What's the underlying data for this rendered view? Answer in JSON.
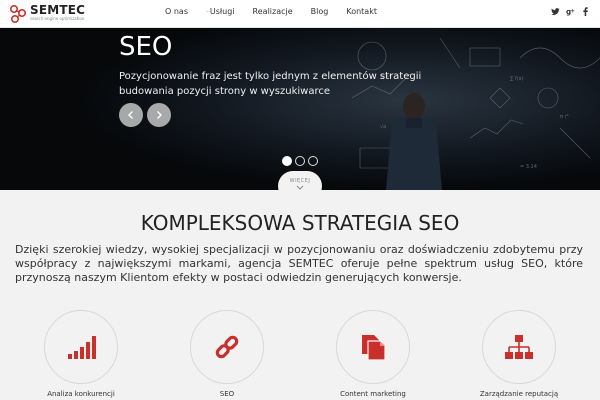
{
  "header": {
    "logo_text": "SEMTEC",
    "logo_sub": "search engine optimization",
    "nav": [
      {
        "label": "O nas",
        "dash": false
      },
      {
        "label": "Usługi",
        "dash": true
      },
      {
        "label": "Realizacje",
        "dash": false
      },
      {
        "label": "Blog",
        "dash": false
      },
      {
        "label": "Kontakt",
        "dash": false
      }
    ],
    "social": [
      {
        "icon": "twitter-icon",
        "glyph": "t"
      },
      {
        "icon": "google-plus-icon",
        "glyph": "g+"
      },
      {
        "icon": "facebook-icon",
        "glyph": "f"
      }
    ]
  },
  "hero": {
    "title": "SEO",
    "text": "Pozycjonowanie fraz jest tylko jednym z elementów strategii budowania pozycji strony w wyszukiwarce",
    "slides_total": 3,
    "active_slide": 1,
    "more_label": "WIĘCEJ"
  },
  "section": {
    "title": "KOMPLEKSOWA STRATEGIA SEO",
    "text": "Dzięki szerokiej wiedzy, wysokiej specjalizacji w pozycjonowaniu oraz doświadczeniu zdobytemu przy współpracy z największymi markami, agencja SEMTEC oferuje pełne spektrum usług SEO, które przynoszą naszym Klientom efekty w postaci odwiedzin generujących konwersje."
  },
  "features": [
    {
      "label": "Analiza konkurencji",
      "icon": "bar-chart-icon"
    },
    {
      "label": "SEO",
      "icon": "link-icon"
    },
    {
      "label": "Content marketing",
      "icon": "documents-icon"
    },
    {
      "label": "Zarządzanie reputacją",
      "icon": "sitemap-icon"
    }
  ],
  "colors": {
    "accent": "#c9302c",
    "hero_bg": "#0a0d10",
    "section_bg": "#f2f2f2"
  }
}
